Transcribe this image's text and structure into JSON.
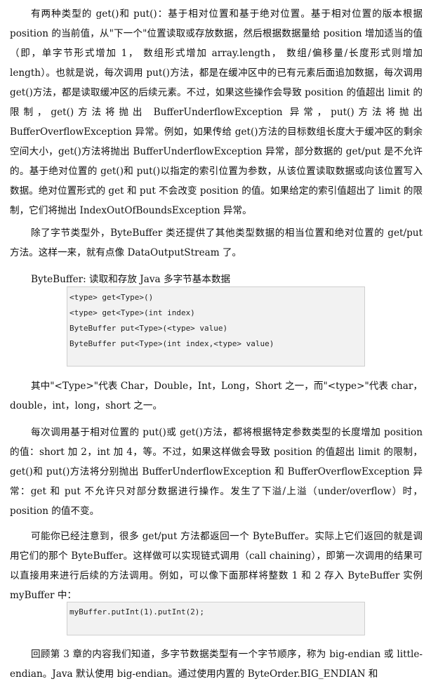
{
  "paragraphs": [
    "有两种类型的 get()和 put()：基于相对位置和基于绝对位置。基于相对位置的版本根据 position 的当前值，从\"下一个\"位置读取或存放数据，然后根据数据量给 position 增加适当的值（即，单字节形式增加 1， 数组形式增加 array.length， 数组/偏移量/长度形式则增加 length）。也就是说，每次调用 put()方法，都是在缓冲区中的已有元素后面追加数据，每次调用 get()方法，都是读取缓冲区的后续元素。不过，如果这些操作会导致 position 的值超出 limit 的限制，get()方法将抛出 BufferUnderflowException 异常，put()方法将抛出 BufferOverflowException 异常。例如，如果传给 get()方法的目标数组长度大于缓冲区的剩余空间大小，get()方法将抛出 BufferUnderflowException 异常，部分数据的 get/put 是不允许的。基于绝对位置的 get()和 put()以指定的索引位置为参数，从该位置读取数据或向该位置写入数据。绝对位置形式的 get 和 put 不会改变 position 的值。如果给定的索引值超出了 limit 的限制，它们将抛出 IndexOutOfBoundsException 异常。",
    "除了字节类型外，ByteBuffer 类还提供了其他类型数据的相当位置和绝对位置的 get/put 方法。这样一来，就有点像 DataOutputStream 了。",
    "其中\"<Type>\"代表 Char，Double，Int，Long，Short 之一，而\"<type>\"代表 char，double，int，long，short 之一。",
    "每次调用基于相对位置的 put()或 get()方法，都将根据特定参数类型的长度增加 position 的值：short 加 2，int 加 4，等。不过，如果这样做会导致 position 的值超出 limit 的限制，get()和 put()方法将分别抛出 BufferUnderflowException 和 BufferOverflowException 异常：get 和 put 不允许只对部分数据进行操作。发生了下溢/上溢（under/overflow）时，position 的值不变。",
    "可能你已经注意到，很多 get/put 方法都返回一个 ByteBuffer。实际上它们返回的就是调用它们的那个 ByteBuffer。这样做可以实现链式调用（call chaining），即第一次调用的结果可以直接用来进行后续的方法调用。例如，可以像下面那样将整数 1 和 2 存入 ByteBuffer 实例 myBuffer 中：",
    "回顾第 3 章的内容我们知道，多字节数据类型有一个字节顺序，称为 big-endian 或 little-endian。Java 默认使用 big-endian。通过使用内置的 ByteOrder.BIG_ENDIAN 和"
  ],
  "code_label": "ByteBuffer: 读取和存放 Java 多字节基本数据",
  "code_block_1": [
    "<type> get<Type>()",
    "<type> get<Type>(int index)",
    "ByteBuffer put<Type>(<type> value)",
    "ByteBuffer put<Type>(int index,<type> value)"
  ],
  "code_block_2": [
    "myBuffer.putInt(1).putInt(2);"
  ]
}
